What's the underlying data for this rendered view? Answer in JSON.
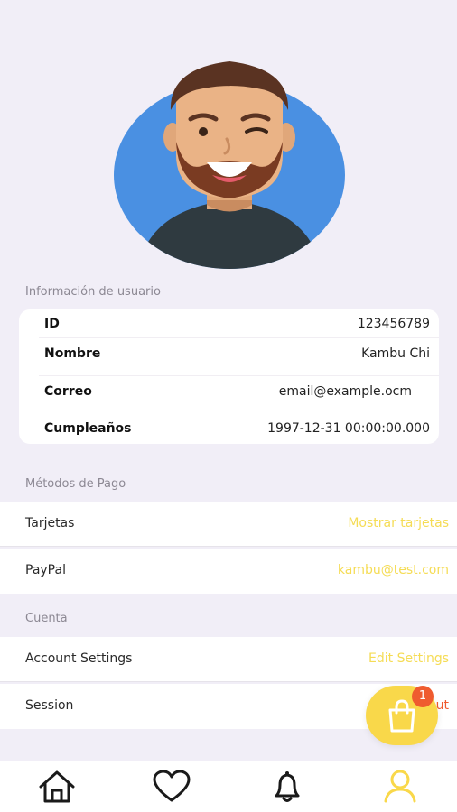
{
  "user_info": {
    "section_label": "Información de usuario",
    "rows": [
      {
        "key": "ID",
        "value": "123456789"
      },
      {
        "key": "Nombre",
        "value": "Kambu Chi"
      },
      {
        "key": "Correo",
        "value": "email@example.ocm"
      },
      {
        "key": "Cumpleaños",
        "value": "1997-12-31 00:00:00.000"
      }
    ]
  },
  "payment": {
    "section_label": "Métodos de Pago",
    "items": [
      {
        "label": "Tarjetas",
        "action": "Mostrar tarjetas"
      },
      {
        "label": "PayPal",
        "action": "kambu@test.com"
      }
    ]
  },
  "account": {
    "section_label": "Cuenta",
    "items": [
      {
        "label": "Account Settings",
        "action": "Edit Settings"
      },
      {
        "label": "Session",
        "action": "ut"
      }
    ]
  },
  "cart": {
    "badge_count": "1",
    "icon": "shopping-bag-icon"
  },
  "colors": {
    "background": "#f1eef7",
    "accent": "#f9d84a",
    "accent_text": "#f5dc55",
    "avatar_bg": "#4a90e2",
    "badge": "#ef5b2f"
  },
  "bottom_nav": {
    "items": [
      {
        "icon": "home-icon"
      },
      {
        "icon": "heart-icon"
      },
      {
        "icon": "bell-icon"
      },
      {
        "icon": "user-icon",
        "active": true
      }
    ]
  }
}
